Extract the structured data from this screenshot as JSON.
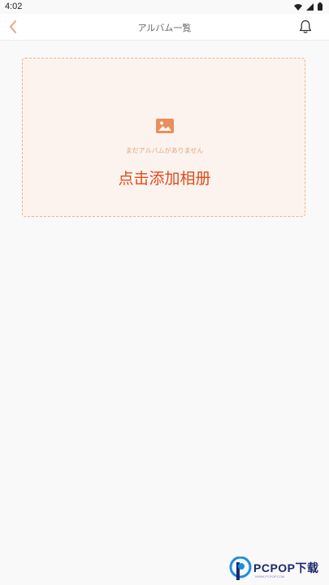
{
  "status_bar": {
    "time": "4:02"
  },
  "header": {
    "title": "アルバム一覧"
  },
  "album_empty": {
    "message": "まだアルバムがありません",
    "add_label": "点击添加相册"
  },
  "watermark": {
    "brand": "PCPOP下载",
    "tagline": "WWW.PCPOP.COM"
  },
  "colors": {
    "accent": "#de4b1e",
    "dashed_border": "#efb38d",
    "panel_bg": "#fdf3ee",
    "icon": "#e88f5d"
  }
}
